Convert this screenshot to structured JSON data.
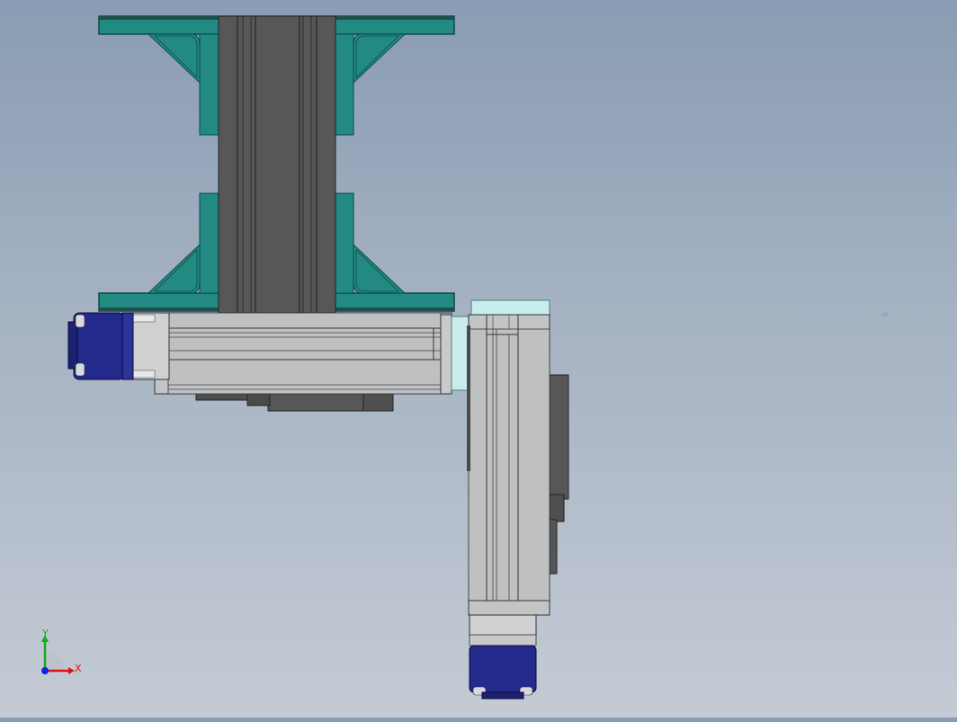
{
  "viewport": {
    "triad": {
      "x_label": "X",
      "y_label": "Y"
    }
  },
  "colors": {
    "background_top": "#8a9cb3",
    "background_bottom": "#c4cbd5",
    "bracket_teal": "#228a82",
    "bracket_edge": "#0e4a45",
    "profile_dark": "#575757",
    "rail_gray": "#c3c4c6",
    "motor_blue": "#232a8c",
    "adapter_cyan": "#c9ecec",
    "axis_x": "#e01010",
    "axis_y": "#10b020",
    "axis_z": "#1020e0"
  }
}
